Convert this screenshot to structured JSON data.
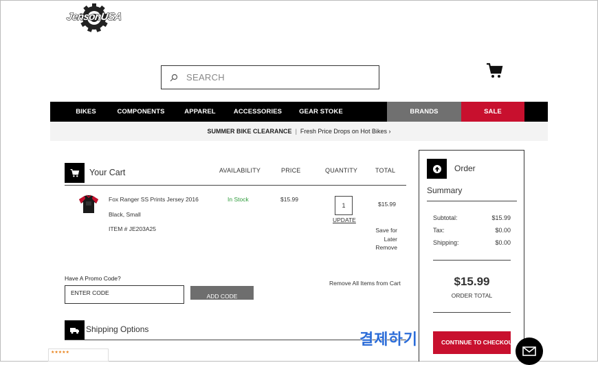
{
  "header": {
    "logo_text": "JensonUSA",
    "search_placeholder": "SEARCH",
    "icons": {
      "search": "search-icon",
      "cart": "cart-icon"
    }
  },
  "nav": {
    "items": [
      "BIKES",
      "COMPONENTS",
      "APPAREL",
      "ACCESSORIES",
      "GEAR STOKE",
      "BRANDS",
      "SALE"
    ],
    "colors": {
      "bar": "#000000",
      "brands": "#707070",
      "sale": "#c8102e"
    }
  },
  "promo_bar": {
    "bold": "SUMMER BIKE CLEARANCE",
    "separator": "|",
    "text": "Fresh Price Drops on Hot Bikes ›"
  },
  "cart": {
    "title": "Your Cart",
    "columns": [
      "AVAILABILITY",
      "PRICE",
      "QUANTITY",
      "TOTAL"
    ],
    "item": {
      "name": "Fox Ranger SS Prints Jersey 2016",
      "variant": "Black, Small",
      "item_number": "ITEM # JE203A25",
      "availability": "In Stock",
      "price": "$15.99",
      "quantity": "1",
      "update_label": "UPDATE",
      "total": "$15.99",
      "save_for": "Save for",
      "later": "Later",
      "remove": "Remove"
    },
    "promo": {
      "label": "Have A Promo Code?",
      "placeholder": "ENTER CODE",
      "button": "ADD CODE"
    },
    "remove_all": "Remove All Items from Cart",
    "shipping_title": "Shipping Options",
    "reviews_stars": "★★★★★"
  },
  "summary": {
    "order_label": "Order",
    "summary_label": "Summary",
    "rows": [
      {
        "label": "Subtotal:",
        "value": "$15.99"
      },
      {
        "label": "Tax:",
        "value": "$0.00"
      },
      {
        "label": "Shipping:",
        "value": "$0.00"
      }
    ],
    "total": "$15.99",
    "total_label": "ORDER TOTAL",
    "checkout_label": "CONTINUE TO CHECKOUT"
  },
  "overlay": {
    "korean_text": "결제하기",
    "korean_color": "#2b6cd8"
  }
}
